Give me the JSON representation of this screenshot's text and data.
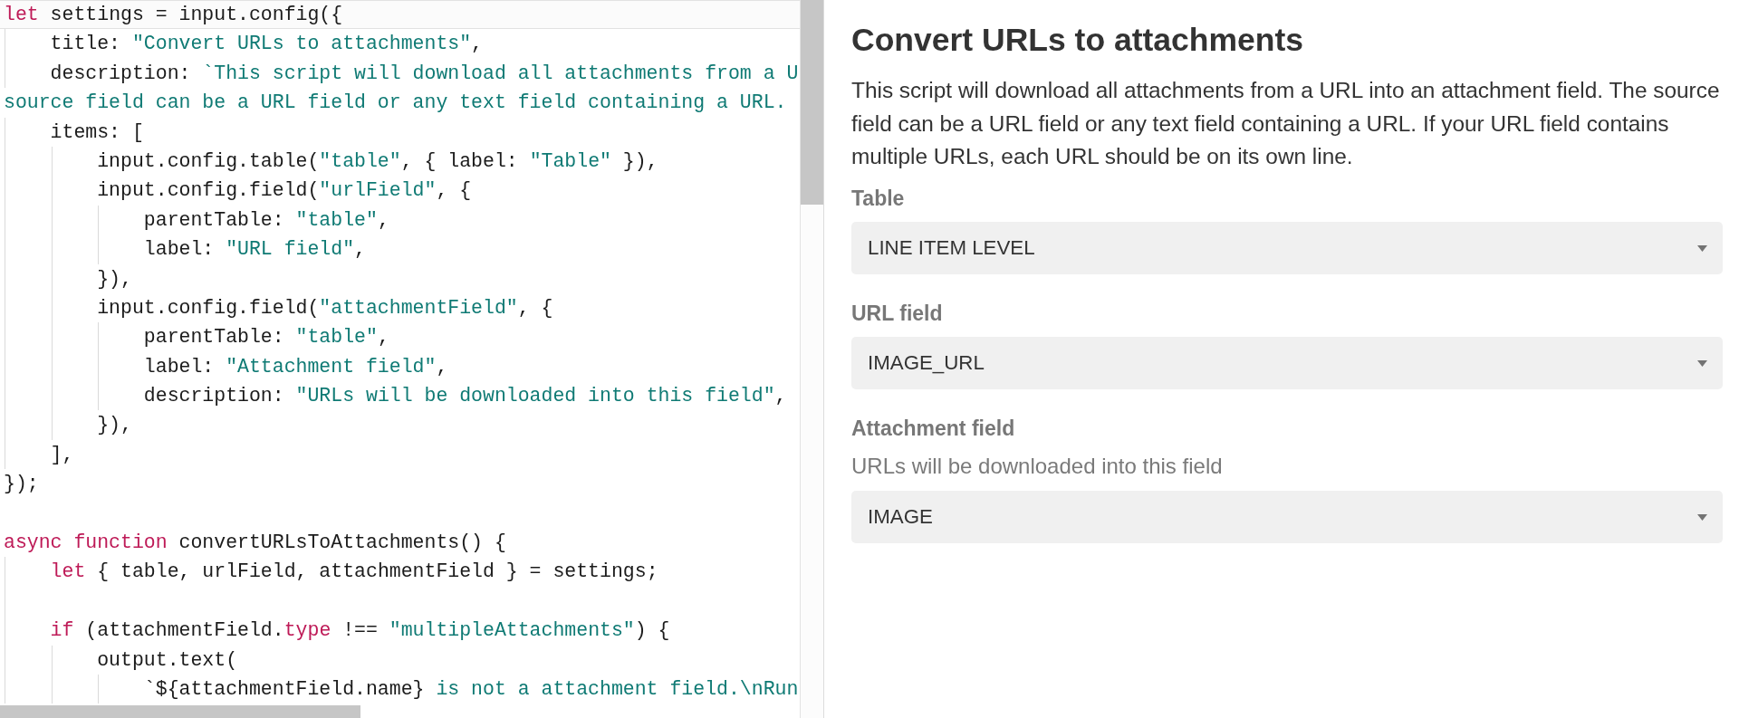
{
  "code_editor": {
    "lines": [
      {
        "active": true,
        "tokens": [
          {
            "kind": "keyword",
            "text": "let"
          },
          {
            "kind": "plain",
            "text": " settings = input.config({"
          }
        ]
      },
      {
        "active": false,
        "tokens": [
          {
            "kind": "plain",
            "text": "    title: "
          },
          {
            "kind": "string",
            "text": "\"Convert URLs to attachments\""
          },
          {
            "kind": "plain",
            "text": ","
          }
        ]
      },
      {
        "active": false,
        "tokens": [
          {
            "kind": "plain",
            "text": "    description: "
          },
          {
            "kind": "string",
            "text": "`This script will download all attachments from a U"
          }
        ]
      },
      {
        "active": false,
        "tokens": [
          {
            "kind": "string",
            "text": "source field can be a URL field or any text field containing a URL."
          }
        ]
      },
      {
        "active": false,
        "tokens": [
          {
            "kind": "plain",
            "text": "    items: ["
          }
        ]
      },
      {
        "active": false,
        "tokens": [
          {
            "kind": "plain",
            "text": "        input.config.table("
          },
          {
            "kind": "string",
            "text": "\"table\""
          },
          {
            "kind": "plain",
            "text": ", { label: "
          },
          {
            "kind": "string",
            "text": "\"Table\""
          },
          {
            "kind": "plain",
            "text": " }),"
          }
        ]
      },
      {
        "active": false,
        "tokens": [
          {
            "kind": "plain",
            "text": "        input.config.field("
          },
          {
            "kind": "string",
            "text": "\"urlField\""
          },
          {
            "kind": "plain",
            "text": ", {"
          }
        ]
      },
      {
        "active": false,
        "tokens": [
          {
            "kind": "plain",
            "text": "            parentTable: "
          },
          {
            "kind": "string",
            "text": "\"table\""
          },
          {
            "kind": "plain",
            "text": ","
          }
        ]
      },
      {
        "active": false,
        "tokens": [
          {
            "kind": "plain",
            "text": "            label: "
          },
          {
            "kind": "string",
            "text": "\"URL field\""
          },
          {
            "kind": "plain",
            "text": ","
          }
        ]
      },
      {
        "active": false,
        "tokens": [
          {
            "kind": "plain",
            "text": "        }),"
          }
        ]
      },
      {
        "active": false,
        "tokens": [
          {
            "kind": "plain",
            "text": "        input.config.field("
          },
          {
            "kind": "string",
            "text": "\"attachmentField\""
          },
          {
            "kind": "plain",
            "text": ", {"
          }
        ]
      },
      {
        "active": false,
        "tokens": [
          {
            "kind": "plain",
            "text": "            parentTable: "
          },
          {
            "kind": "string",
            "text": "\"table\""
          },
          {
            "kind": "plain",
            "text": ","
          }
        ]
      },
      {
        "active": false,
        "tokens": [
          {
            "kind": "plain",
            "text": "            label: "
          },
          {
            "kind": "string",
            "text": "\"Attachment field\""
          },
          {
            "kind": "plain",
            "text": ","
          }
        ]
      },
      {
        "active": false,
        "tokens": [
          {
            "kind": "plain",
            "text": "            description: "
          },
          {
            "kind": "string",
            "text": "\"URLs will be downloaded into this field\""
          },
          {
            "kind": "plain",
            "text": ","
          }
        ]
      },
      {
        "active": false,
        "tokens": [
          {
            "kind": "plain",
            "text": "        }),"
          }
        ]
      },
      {
        "active": false,
        "tokens": [
          {
            "kind": "plain",
            "text": "    ],"
          }
        ]
      },
      {
        "active": false,
        "tokens": [
          {
            "kind": "plain",
            "text": "});"
          }
        ]
      },
      {
        "active": false
      },
      {
        "active": false,
        "tokens": [
          {
            "kind": "keyword",
            "text": "async function"
          },
          {
            "kind": "plain",
            "text": " convertURLsToAttachments() {"
          }
        ]
      },
      {
        "active": false,
        "tokens": [
          {
            "kind": "keyword",
            "text": "    let"
          },
          {
            "kind": "plain",
            "text": " { table, urlField, attachmentField } = settings;"
          }
        ]
      },
      {
        "active": false
      },
      {
        "active": false,
        "tokens": [
          {
            "kind": "keyword",
            "text": "    if"
          },
          {
            "kind": "plain",
            "text": " (attachmentField."
          },
          {
            "kind": "keyword",
            "text": "type"
          },
          {
            "kind": "plain",
            "text": " !== "
          },
          {
            "kind": "string",
            "text": "\"multipleAttachments\""
          },
          {
            "kind": "plain",
            "text": ") {"
          }
        ]
      },
      {
        "active": false,
        "tokens": [
          {
            "kind": "plain",
            "text": "        output.text("
          }
        ]
      },
      {
        "active": false,
        "tokens": [
          {
            "kind": "plain",
            "text": "            `${attachmentField.name}"
          },
          {
            "kind": "string",
            "text": " is not a attachment field.\\nRun"
          }
        ]
      }
    ]
  },
  "form": {
    "title": "Convert URLs to attachments",
    "description": "This script will download all attachments from a URL into an attachment field. The source field can be a URL field or any text field containing a URL. If your URL field contains multiple URLs, each URL should be on its own line.",
    "fields": [
      {
        "label": "Table",
        "value": "LINE ITEM LEVEL"
      },
      {
        "label": "URL field",
        "value": "IMAGE_URL"
      },
      {
        "label": "Attachment field",
        "description": "URLs will be downloaded into this field",
        "value": "IMAGE"
      }
    ]
  }
}
